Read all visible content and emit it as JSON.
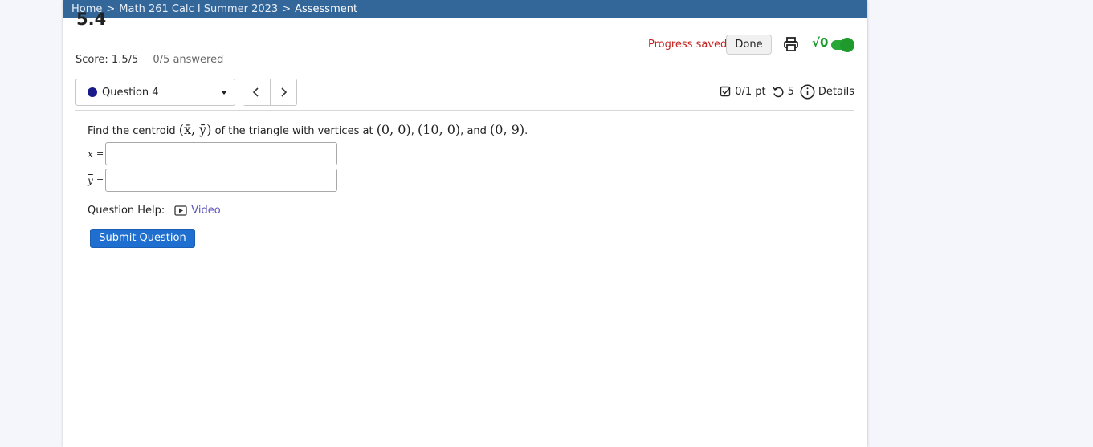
{
  "breadcrumb": {
    "items": [
      "Home",
      "Math 261 Calc I Summer 2023",
      "Assessment"
    ],
    "separator": ">"
  },
  "header": {
    "title": "5.4",
    "score_label": "Score: 1.5/5",
    "answered": "0/5 answered",
    "progress_saved": "Progress saved",
    "done_label": "Done",
    "math_toggle_label": "√0"
  },
  "question_nav": {
    "selected": "Question 4",
    "prev_label": "‹",
    "next_label": "›"
  },
  "meta": {
    "points": "0/1 pt",
    "attempts": "5",
    "details_label": "Details"
  },
  "question": {
    "text_before": "Find the centroid ",
    "centroid": "(x̄, ȳ)",
    "text_mid": " of the triangle with vertices at ",
    "v1": "(0, 0)",
    "v2": "(10, 0)",
    "v3": "(0, 9)",
    "and_word": "and",
    "x_var": "x",
    "y_var": "y",
    "eq": "=",
    "x_value": "",
    "y_value": ""
  },
  "help": {
    "label": "Question Help:",
    "video_label": "Video"
  },
  "submit_label": "Submit Question",
  "colors": {
    "topbar": "#336699",
    "progress_saved": "#c0231f",
    "toggle_green": "#27a737",
    "submit_blue": "#1e6fd0",
    "link_purple": "#5b55b8"
  }
}
